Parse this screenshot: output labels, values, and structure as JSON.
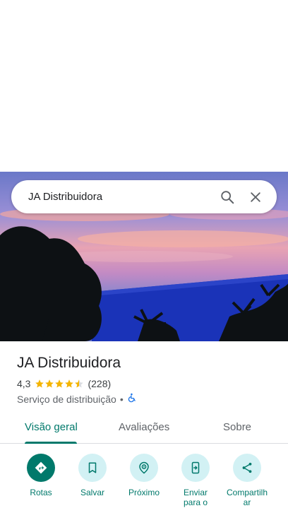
{
  "search": {
    "query": "JA Distribuidora"
  },
  "place": {
    "name": "JA Distribuidora",
    "rating": "4,3",
    "stars": 4.3,
    "reviews": "(228)",
    "category": "Serviço de distribuição",
    "separator": "•"
  },
  "tabs": [
    {
      "label": "Visão geral"
    },
    {
      "label": "Avaliações"
    },
    {
      "label": "Sobre"
    }
  ],
  "actions": [
    {
      "label": "Rotas",
      "icon": "directions-icon"
    },
    {
      "label": "Salvar",
      "icon": "bookmark-icon"
    },
    {
      "label": "Próximo",
      "icon": "nearby-icon"
    },
    {
      "label": "Enviar para o",
      "icon": "send-to-phone-icon"
    },
    {
      "label": "Compartilhar",
      "icon": "share-icon"
    }
  ],
  "colors": {
    "accent": "#00796b",
    "chip": "#d2f1f4",
    "star": "#f4b400"
  }
}
